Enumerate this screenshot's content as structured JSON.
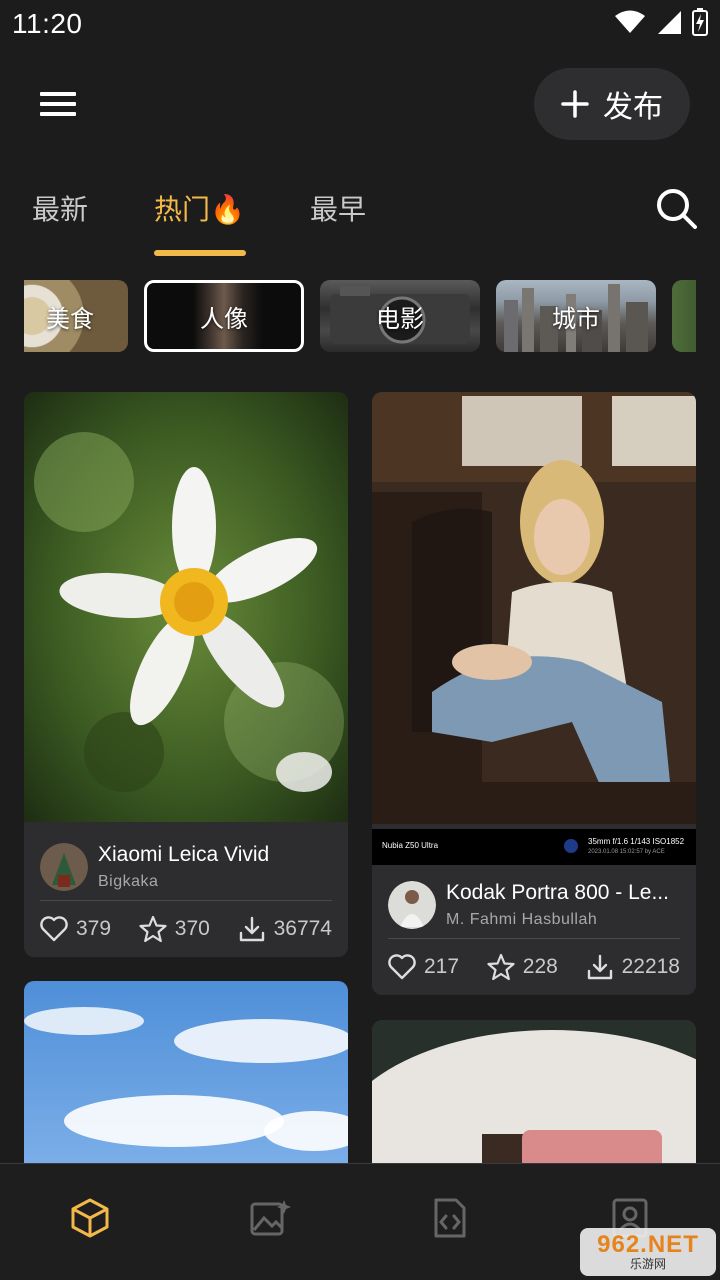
{
  "status": {
    "time": "11:20"
  },
  "header": {
    "publish_label": "发布"
  },
  "tabs": [
    {
      "label": "最新"
    },
    {
      "label": "热门🔥"
    },
    {
      "label": "最早"
    }
  ],
  "categories": [
    {
      "label": "美食"
    },
    {
      "label": "人像"
    },
    {
      "label": "电影"
    },
    {
      "label": "城市"
    }
  ],
  "cards": [
    {
      "title": "Xiaomi Leica Vivid",
      "author": "Bigkaka",
      "likes": "379",
      "stars": "370",
      "downloads": "36774"
    },
    {
      "title": "Kodak Portra 800 - Le...",
      "author": "M. Fahmi Hasbullah",
      "likes": "217",
      "stars": "228",
      "downloads": "22218",
      "exif_device": "Nubia Z50 Ultra",
      "exif_params": "35mm f/1.6 1/143 ISO1852",
      "exif_date": "2023.01.08 15:02:57 by ACE"
    }
  ],
  "watermark": {
    "top": "962.NET",
    "bottom": "乐游网"
  },
  "colors": {
    "accent": "#f3b84a",
    "background": "#1c1c1d",
    "card": "#2d2d2f"
  }
}
